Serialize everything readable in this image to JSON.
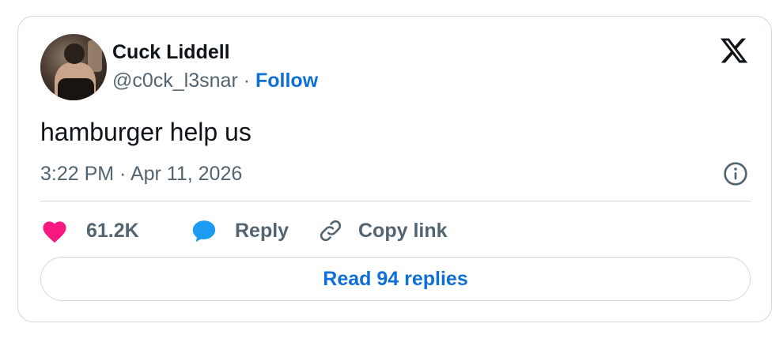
{
  "author": {
    "name": "Cuck Liddell",
    "handle": "@c0ck_l3snar",
    "separator": " · ",
    "follow_label": "Follow"
  },
  "brand": {
    "logo_icon": "x-logo-icon"
  },
  "tweet": {
    "text": "hamburger help us",
    "timestamp": "3:22 PM · Apr 11, 2026"
  },
  "actions": {
    "likes_count": "61.2K",
    "reply_label": "Reply",
    "copy_link_label": "Copy link",
    "read_replies_label": "Read 94 replies"
  },
  "colors": {
    "heart": "#f91880",
    "reply_bubble": "#1d9bf0",
    "link": "#0f6fd6",
    "secondary_text": "#536471",
    "border": "#cfd9de"
  },
  "icons": {
    "like": "heart-icon",
    "reply": "speech-bubble-icon",
    "copy_link": "link-icon",
    "info": "info-icon"
  }
}
